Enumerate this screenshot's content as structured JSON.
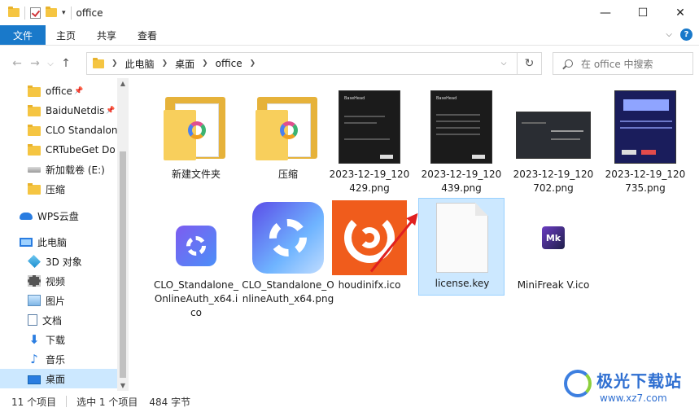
{
  "window": {
    "title": "office",
    "controls": {
      "minimize": "—",
      "maximize": "☐",
      "close": "✕"
    }
  },
  "ribbon": {
    "tabs": [
      "文件",
      "主页",
      "共享",
      "查看"
    ],
    "help": "?"
  },
  "nav": {
    "back": "←",
    "forward": "→",
    "recent": "⌵",
    "up": "↑",
    "breadcrumb": [
      "此电脑",
      "桌面",
      "office"
    ],
    "refresh": "↻",
    "search_placeholder": "在 office 中搜索"
  },
  "sidebar": {
    "items": [
      {
        "label": "office",
        "icon": "folder-icon",
        "pinned": true
      },
      {
        "label": "BaiduNetdis",
        "icon": "folder-icon",
        "pinned": true
      },
      {
        "label": "CLO Standalon",
        "icon": "folder-icon"
      },
      {
        "label": "CRTubeGet Do",
        "icon": "folder-icon"
      },
      {
        "label": "新加载卷 (E:)",
        "icon": "drive-icon"
      },
      {
        "label": "压缩",
        "icon": "folder-icon"
      },
      {
        "label": "WPS云盘",
        "icon": "cloud-icon"
      },
      {
        "label": "此电脑",
        "icon": "pc-icon"
      },
      {
        "label": "3D 对象",
        "icon": "3d-objects-icon"
      },
      {
        "label": "视频",
        "icon": "video-icon"
      },
      {
        "label": "图片",
        "icon": "pictures-icon"
      },
      {
        "label": "文档",
        "icon": "documents-icon"
      },
      {
        "label": "下载",
        "icon": "download-icon"
      },
      {
        "label": "音乐",
        "icon": "music-icon"
      },
      {
        "label": "桌面",
        "icon": "desktop-icon",
        "selected": true
      }
    ],
    "pin_glyph": "📌"
  },
  "files": [
    {
      "name": "新建文件夹",
      "type": "folder"
    },
    {
      "name": "压缩",
      "type": "folder"
    },
    {
      "name": "2023-12-19_120429.png",
      "type": "screenshot"
    },
    {
      "name": "2023-12-19_120439.png",
      "type": "screenshot"
    },
    {
      "name": "2023-12-19_120702.png",
      "type": "screenshot"
    },
    {
      "name": "2023-12-19_120735.png",
      "type": "screenshot"
    },
    {
      "name": "CLO_Standalone_OnlineAuth_x64.ico",
      "type": "ico"
    },
    {
      "name": "CLO_Standalone_OnlineAuth_x64.png",
      "type": "png"
    },
    {
      "name": "houdinifx.ico",
      "type": "ico"
    },
    {
      "name": "license.key",
      "type": "key",
      "selected": true
    },
    {
      "name": "MiniFreak V.ico",
      "type": "ico"
    }
  ],
  "thumbs": {
    "basehead": "BaseHead",
    "minifreak": "Mk"
  },
  "status": {
    "count": "11 个项目",
    "selection": "选中 1 个项目",
    "size": "484 字节"
  },
  "watermark": {
    "title": "极光下载站",
    "url": "www.xz7.com"
  }
}
